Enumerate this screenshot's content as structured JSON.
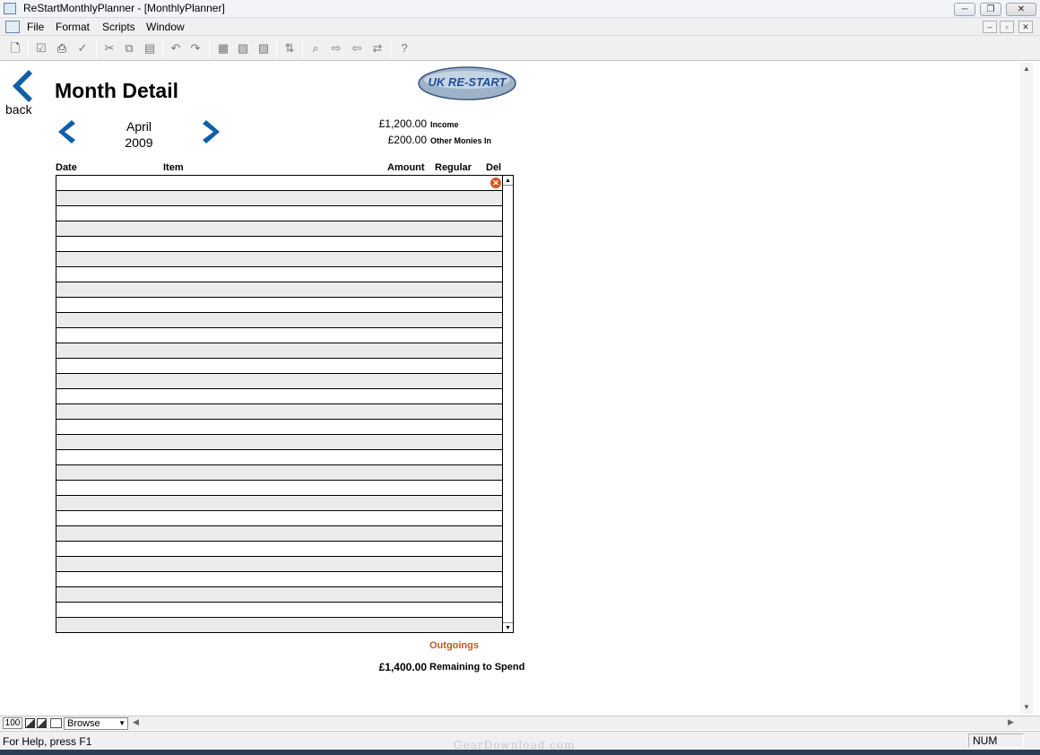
{
  "window": {
    "title": "ReStartMonthlyPlanner - [MonthlyPlanner]",
    "min_symbol": "─",
    "restore_symbol": "❐",
    "close_symbol": "✕"
  },
  "menu": {
    "items": [
      "File",
      "Format",
      "Scripts",
      "Window"
    ],
    "mdi_min": "–",
    "mdi_restore": "▫",
    "mdi_close": "✕"
  },
  "toolbar": {
    "icons": [
      "new-document-icon",
      "check-icon",
      "print-icon",
      "spellcheck-icon",
      "cut-icon",
      "copy-icon",
      "paste-icon",
      "undo-icon",
      "redo-icon",
      "new-record-icon",
      "duplicate-record-icon",
      "delete-record-icon",
      "sort-icon",
      "find-icon",
      "find-next-icon",
      "find-previous-icon",
      "replace-icon",
      "help-icon"
    ]
  },
  "page": {
    "back_label": "back",
    "title": "Month Detail",
    "logo_text": "UK RE-START",
    "month": "April",
    "year": "2009",
    "income_amount": "£1,200.00",
    "income_label": "Income",
    "other_amount": "£200.00",
    "other_label": "Other Monies In",
    "columns": {
      "date": "Date",
      "item": "Item",
      "amount": "Amount",
      "regular": "Regular",
      "del": "Del"
    },
    "row_count": 30,
    "delete_icon": "✕",
    "outgoings_label": "Outgoings",
    "remaining_amount": "£1,400.00",
    "remaining_label": "Remaining to Spend"
  },
  "modebar": {
    "zoom": "100",
    "mode": "Browse",
    "mode_caret": "▼",
    "left_arrow": "◀",
    "right_arrow": "▶"
  },
  "status": {
    "help": "For Help, press F1",
    "num": "NUM"
  },
  "watermark": "GearDownload.com",
  "colors": {
    "accent_blue": "#0f5fa8",
    "outgoings_orange": "#c0571e",
    "row_alt": "#ebebeb"
  }
}
